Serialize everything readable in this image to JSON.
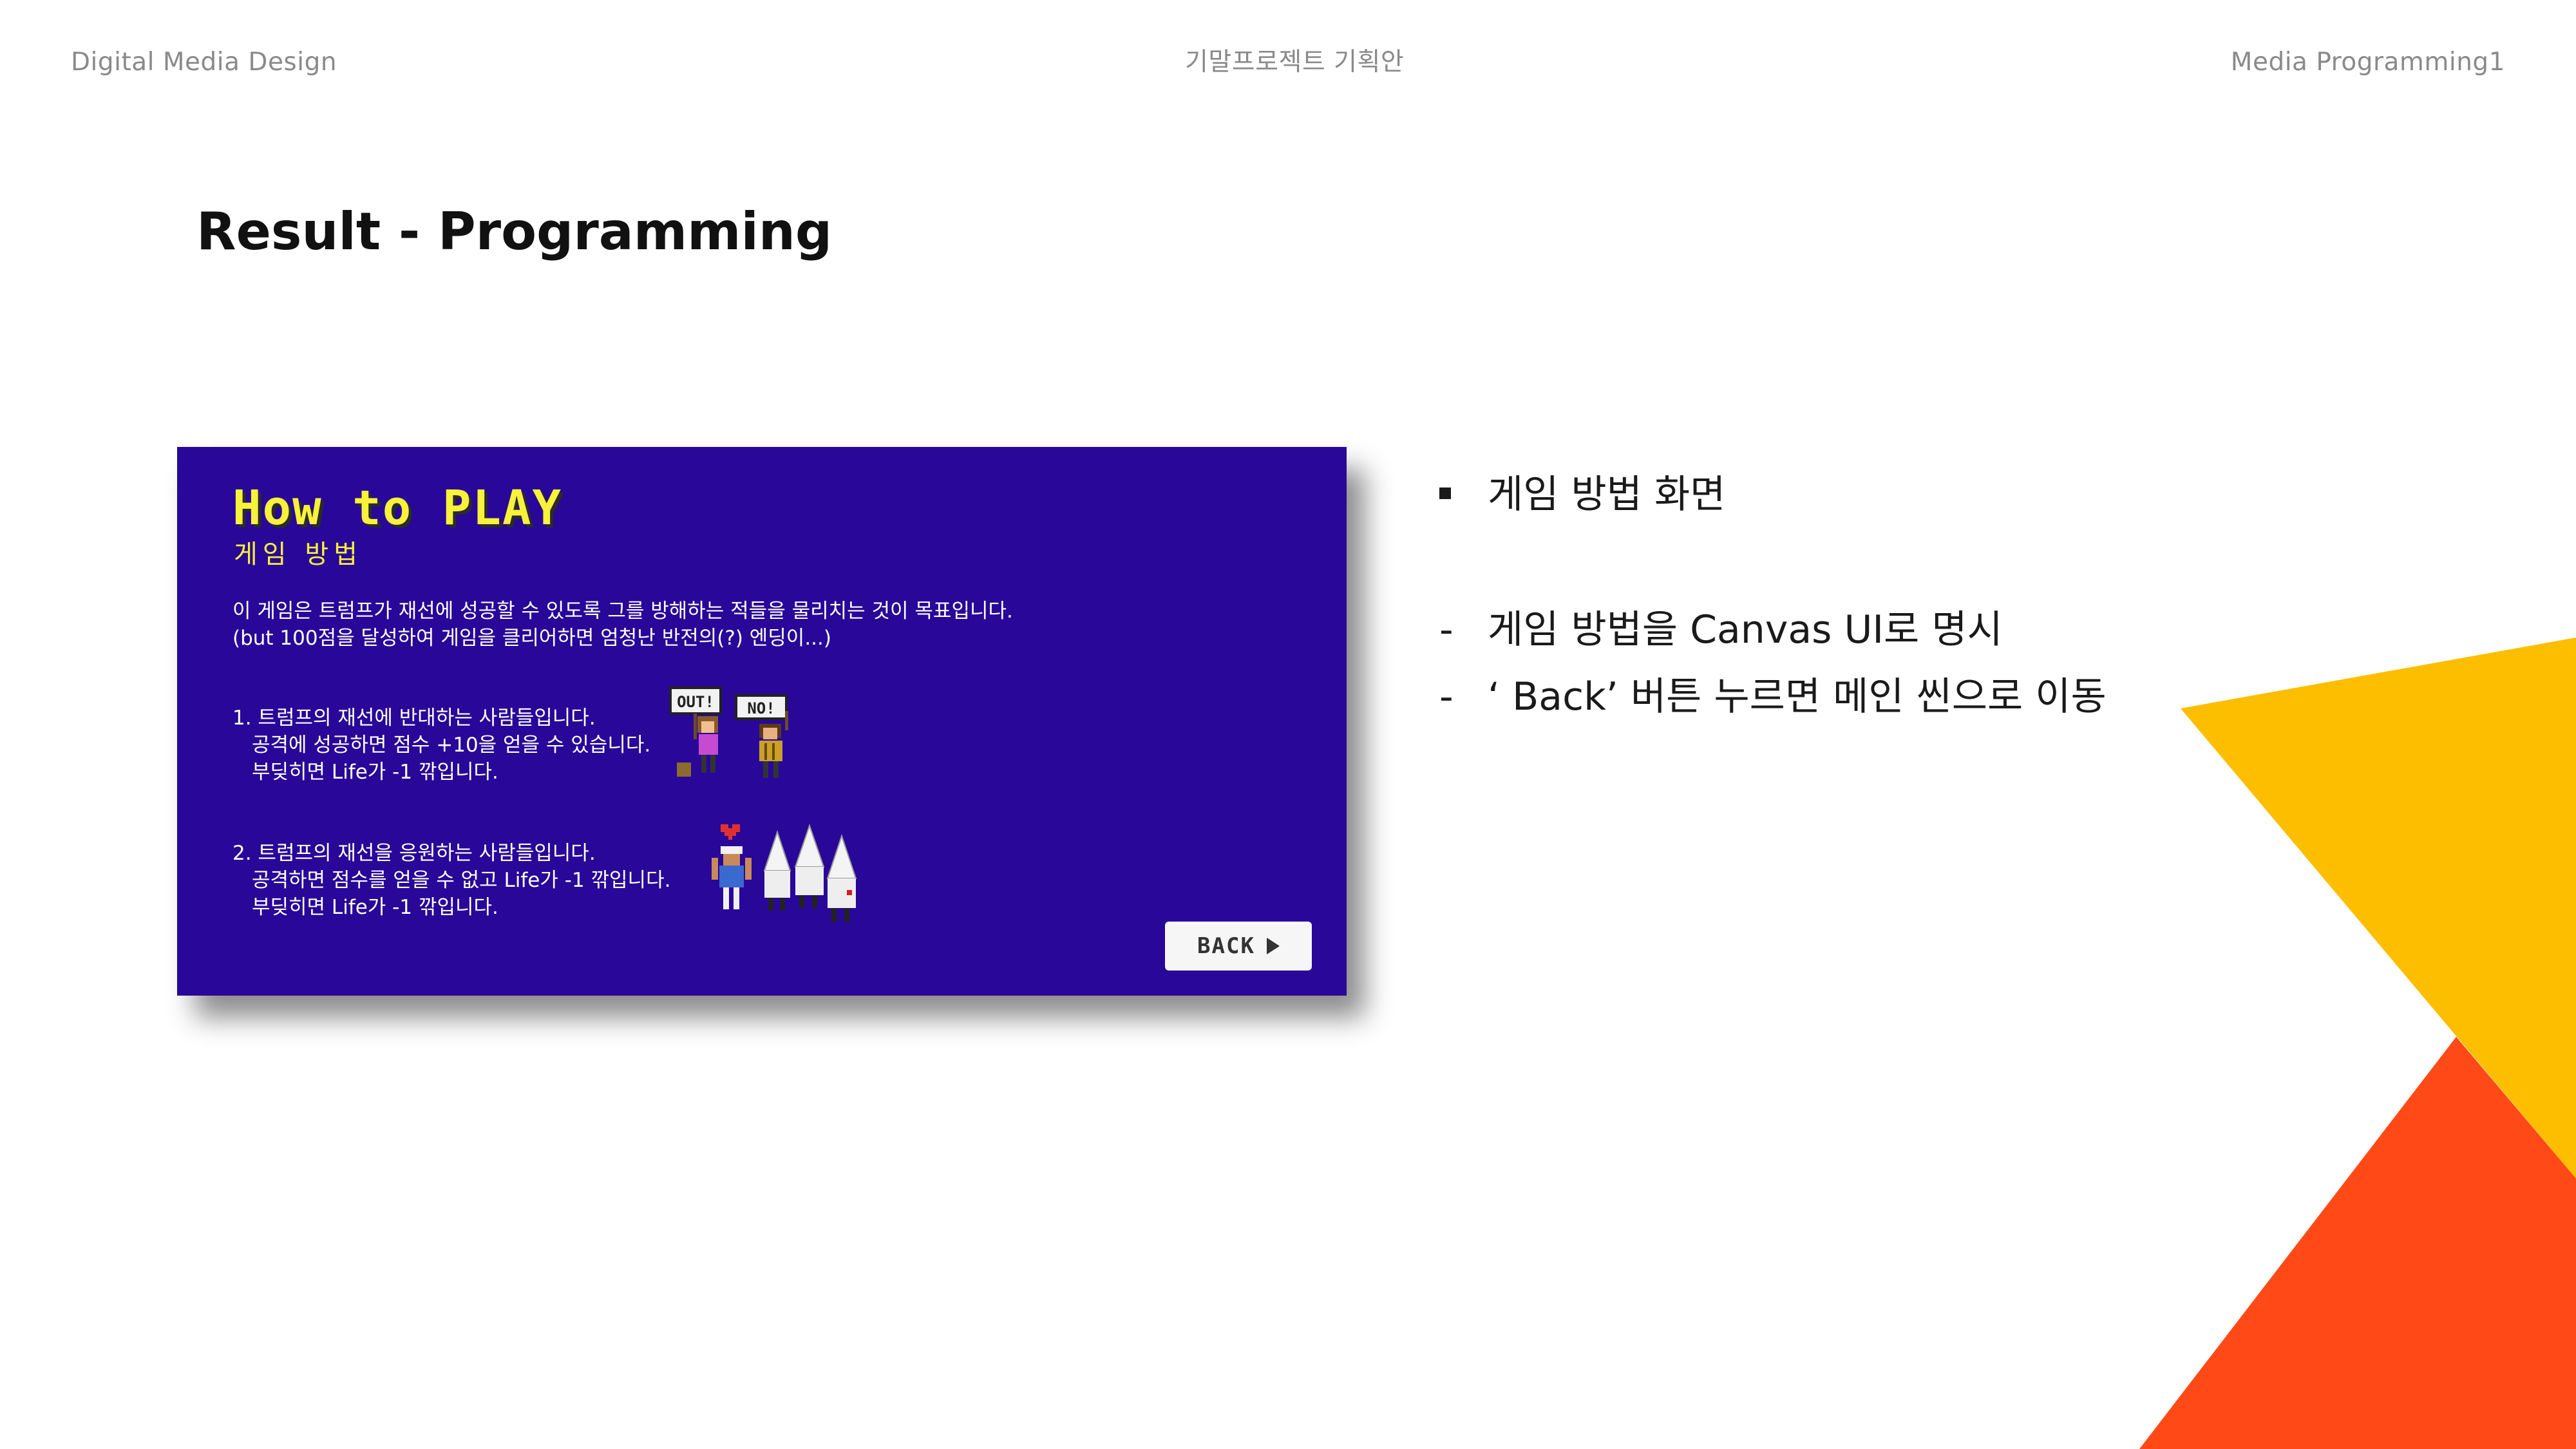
{
  "header": {
    "left": "Digital Media Design",
    "center": "기말프로젝트 기획안",
    "right": "Media Programming1"
  },
  "page_title": "Result - Programming",
  "game_screen": {
    "title": "How to PLAY",
    "subtitle": "게임 방법",
    "intro_lines": [
      "이 게임은 트럼프가 재선에 성공할 수 있도록 그를 방해하는 적들을 물리치는 것이 목표입니다.",
      "(but 100점을 달성하여 게임을 클리어하면 엄청난 반전의(?) 엔딩이...)"
    ],
    "rule1_lines": [
      "1. 트럼프의 재선에 반대하는 사람들입니다.",
      "공격에 성공하면 점수 +10을 얻을 수 있습니다.",
      "부딪히면 Life가 -1 깎입니다."
    ],
    "rule2_lines": [
      "2. 트럼프의 재선을 응원하는 사람들입니다.",
      "공격하면 점수를 얻을 수 없고 Life가 -1 깎입니다.",
      "부딪히면 Life가 -1 깎입니다."
    ],
    "sign_labels": [
      "OUT!",
      "NO!"
    ],
    "back_button": "BACK"
  },
  "bullets": [
    "게임 방법 화면",
    "게임 방법을 Canvas UI로 명시",
    "‘ Back’ 버튼 누르면 메인 씬으로 이동"
  ],
  "bullet_markers": [
    "-",
    "-"
  ],
  "colors": {
    "panel_bg": "#290798",
    "title_yellow": "#f7f23a",
    "triangle_yellow": "#FDBE00",
    "triangle_orange": "#FF4A17"
  }
}
